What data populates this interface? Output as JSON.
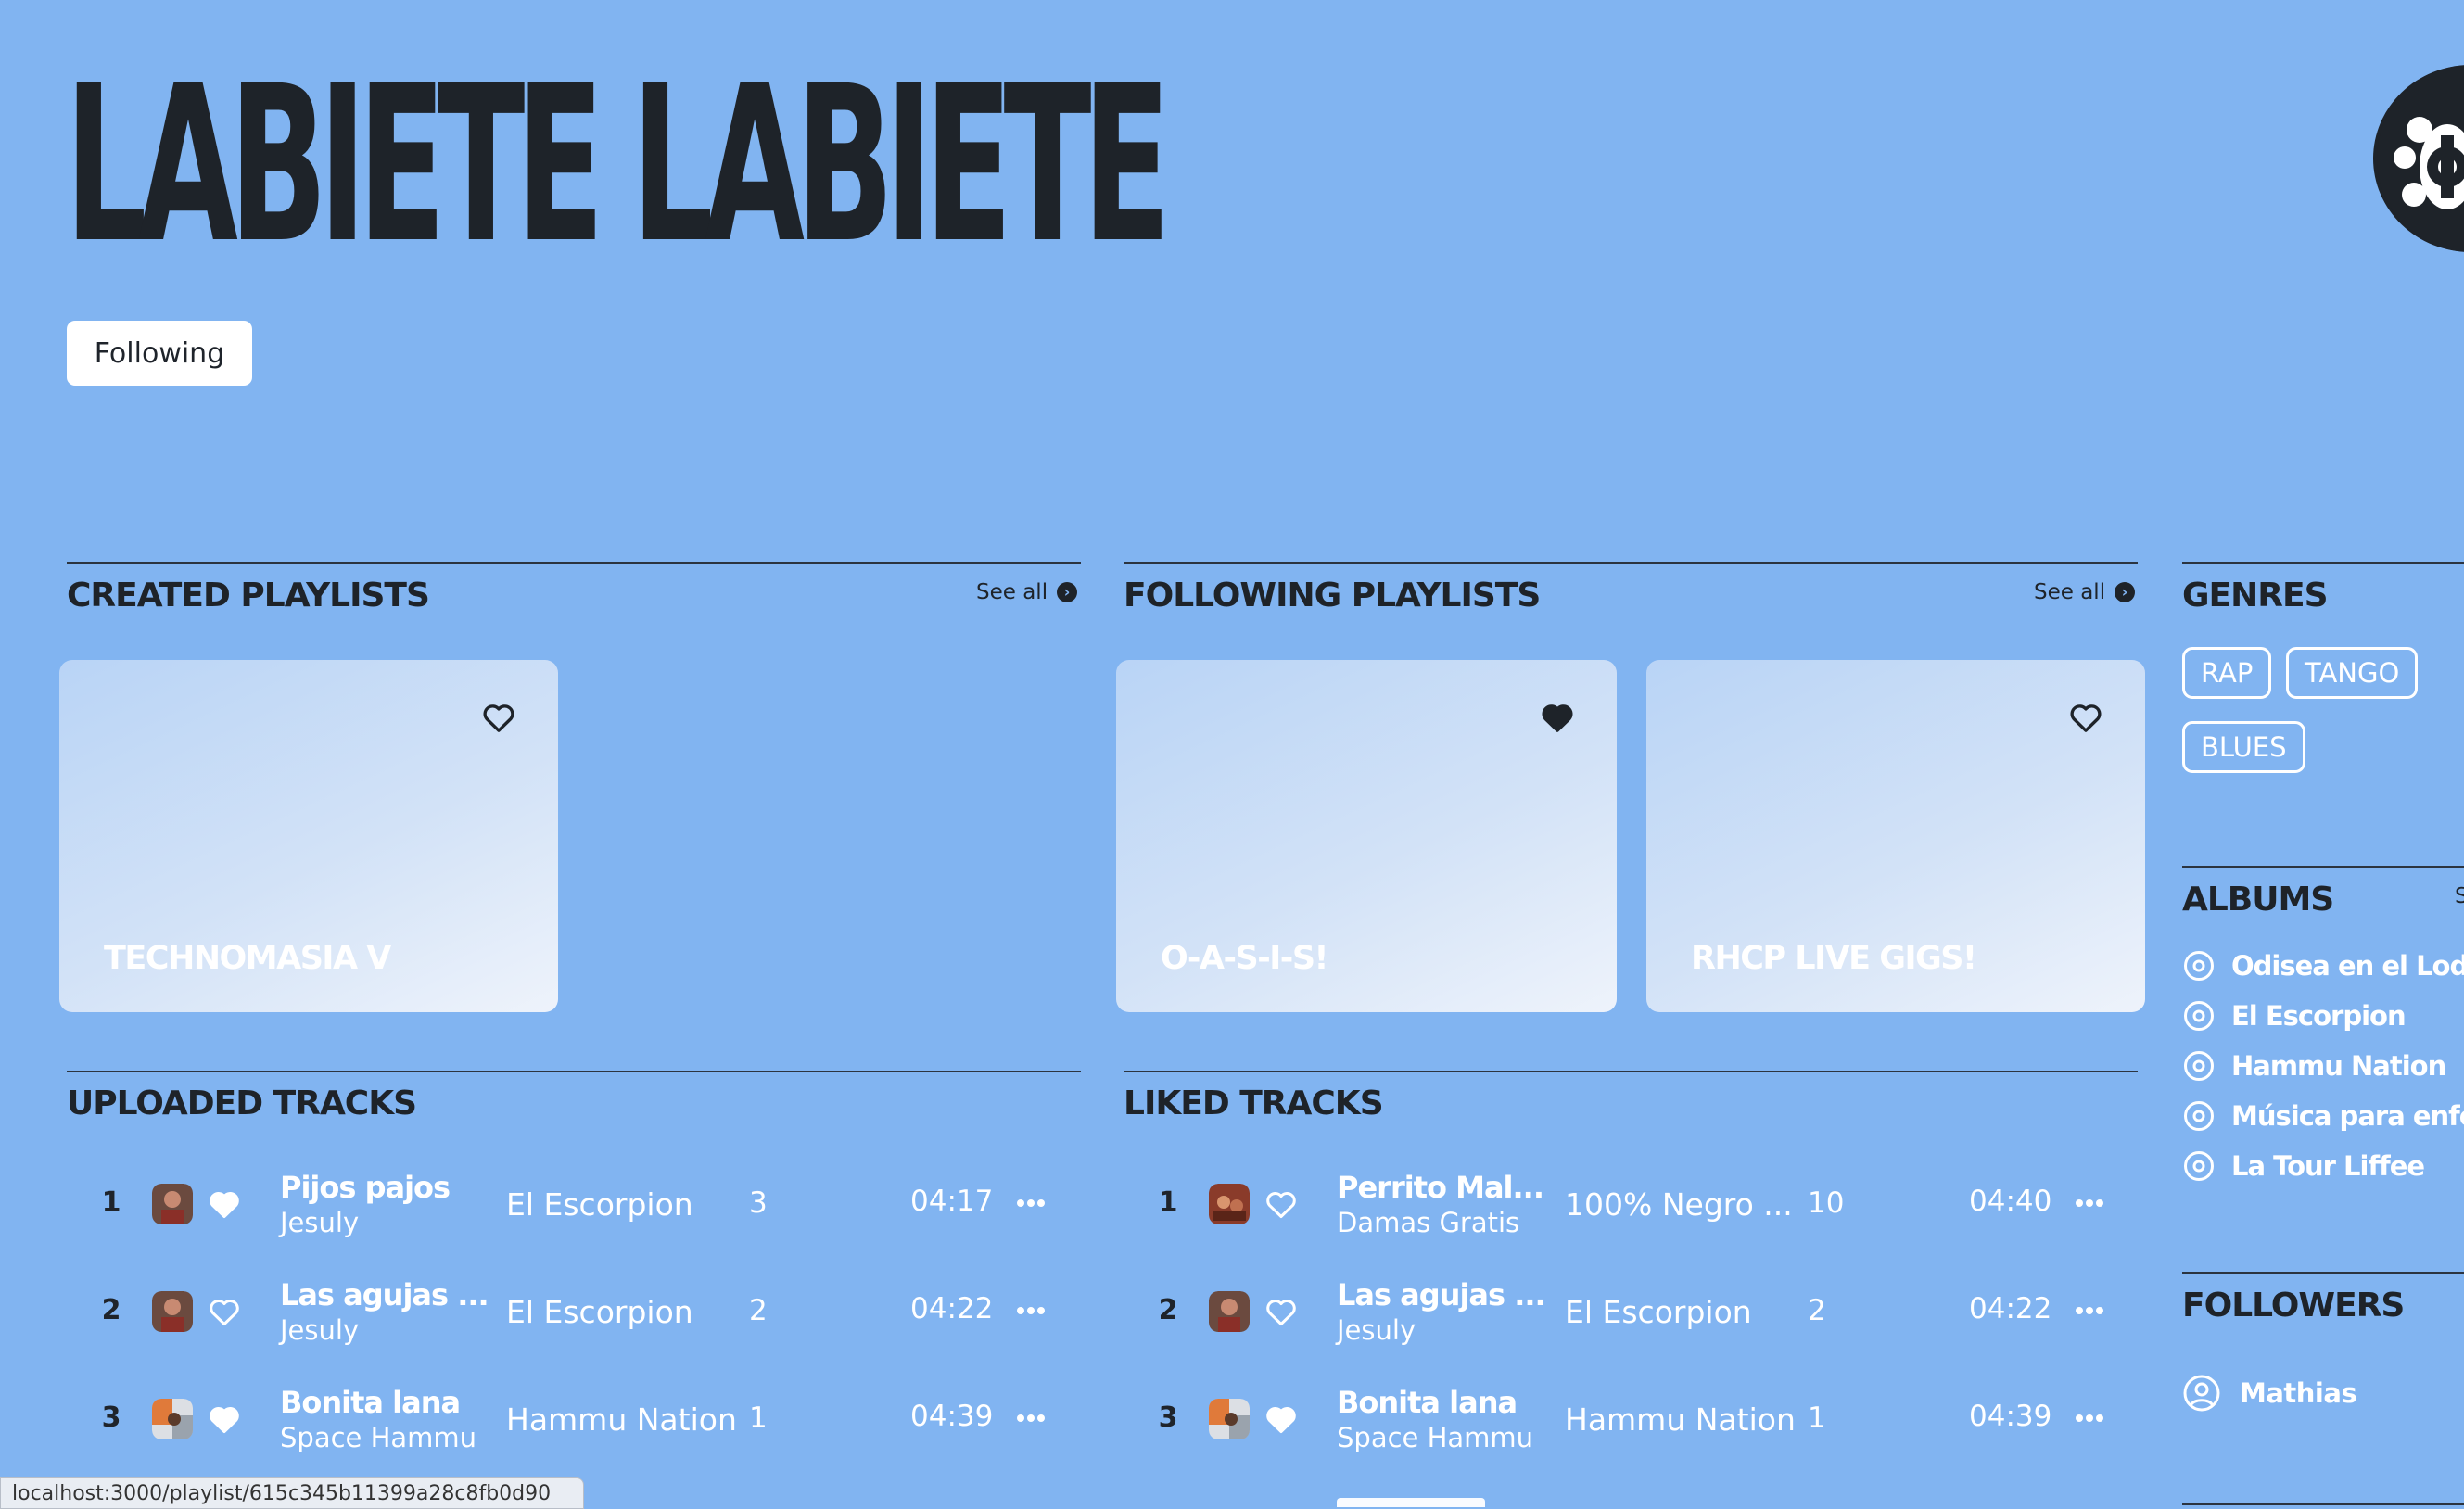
{
  "header": {
    "title": "LABIETE LABIETE",
    "follow_label": "Following"
  },
  "created_playlists": {
    "title": "CREATED PLAYLISTS",
    "see_all": "See all",
    "items": [
      {
        "name": "TECHNOMASIA V",
        "liked": false
      }
    ]
  },
  "following_playlists": {
    "title": "FOLLOWING PLAYLISTS",
    "see_all": "See all",
    "items": [
      {
        "name": "O-A-S-I-S!",
        "liked": true
      },
      {
        "name": "RHCP LIVE GIGS!",
        "liked": false
      }
    ]
  },
  "genres": {
    "title": "GENRES",
    "items": [
      "RAP",
      "TANGO",
      "BLUES"
    ]
  },
  "albums": {
    "title": "ALBUMS",
    "see_all": "S",
    "items": [
      "Odisea en el Lodo",
      "El Escorpion",
      "Hammu Nation",
      "Música para enfer",
      "La Tour Liffee"
    ]
  },
  "followers": {
    "title": "FOLLOWERS",
    "items": [
      "Mathias"
    ]
  },
  "uploaded_tracks": {
    "title": "UPLOADED TRACKS",
    "rows": [
      {
        "num": "1",
        "name": "Pijos pajos",
        "artist": "Jesuly",
        "album": "El Escorpion",
        "count": "3",
        "duration": "04:17",
        "liked": true
      },
      {
        "num": "2",
        "name": "Las agujas ...",
        "artist": "Jesuly",
        "album": "El Escorpion",
        "count": "2",
        "duration": "04:22",
        "liked": false
      },
      {
        "num": "3",
        "name": "Bonita lana",
        "artist": "Space Hammu",
        "album": "Hammu Nation",
        "count": "1",
        "duration": "04:39",
        "liked": true
      }
    ]
  },
  "liked_tracks": {
    "title": "LIKED TRACKS",
    "rows": [
      {
        "num": "1",
        "name": "Perrito Mal...",
        "artist": "Damas Gratis",
        "album": "100% Negro ...",
        "count": "10",
        "duration": "04:40",
        "liked": false
      },
      {
        "num": "2",
        "name": "Las agujas ...",
        "artist": "Jesuly",
        "album": "El Escorpion",
        "count": "2",
        "duration": "04:22",
        "liked": false
      },
      {
        "num": "3",
        "name": "Bonita lana",
        "artist": "Space Hammu",
        "album": "Hammu Nation",
        "count": "1",
        "duration": "04:39",
        "liked": true
      }
    ]
  },
  "status_bar": {
    "url": "localhost:3000/playlist/615c345b11399a28c8fb0d90"
  },
  "colors": {
    "background": "#81b4f1",
    "ink": "#1e2329",
    "white": "#ffffff"
  },
  "icons": {
    "heart_outline": "heart-outline-icon",
    "heart_filled": "heart-filled-icon",
    "more": "more-dots-icon",
    "arrow": "arrow-right-circle-icon",
    "album": "disc-icon",
    "user": "user-circle-icon"
  }
}
